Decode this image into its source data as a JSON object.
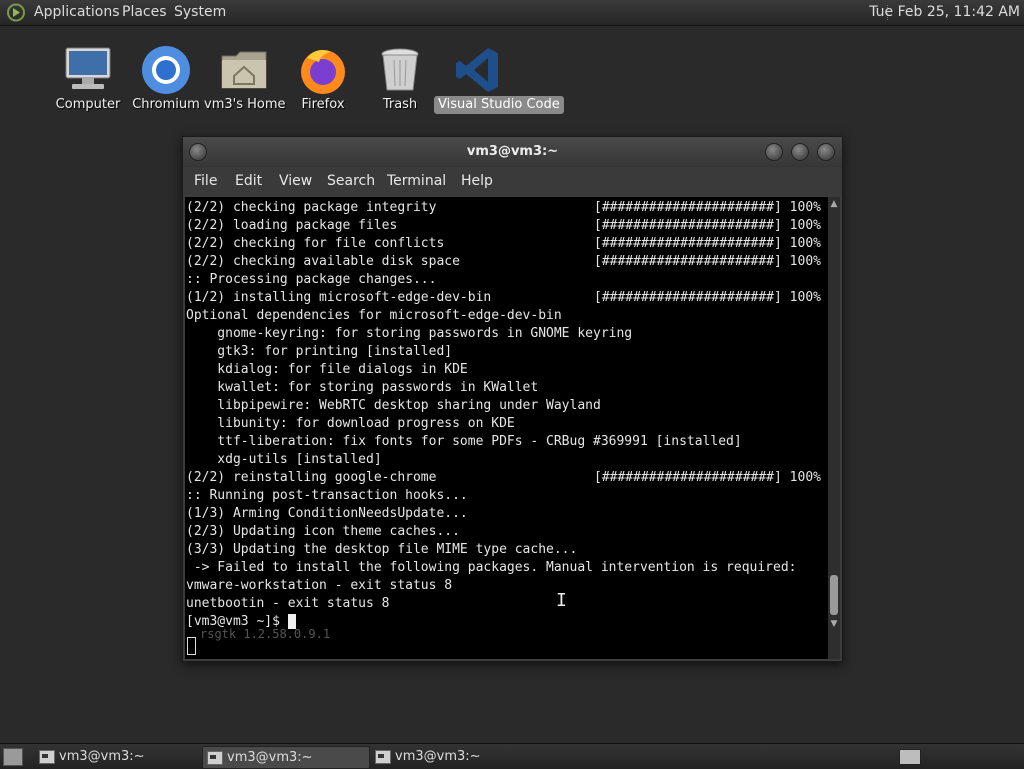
{
  "top_panel": {
    "menus": [
      "Applications",
      "Places",
      "System"
    ],
    "clock": "Tue Feb 25, 11:42 AM"
  },
  "desktop_icons": [
    {
      "label": "Computer",
      "icon": "computer-icon"
    },
    {
      "label": "Chromium",
      "icon": "chromium-icon"
    },
    {
      "label": "vm3's Home",
      "icon": "home-folder-icon"
    },
    {
      "label": "Firefox",
      "icon": "firefox-icon"
    },
    {
      "label": "Trash",
      "icon": "trash-icon"
    },
    {
      "label": "Visual Studio Code",
      "icon": "vscode-icon",
      "selected": true
    }
  ],
  "terminal": {
    "title": "vm3@vm3:~",
    "menu": [
      "File",
      "Edit",
      "View",
      "Search",
      "Terminal",
      "Help"
    ],
    "lines": [
      {
        "text": "(2/2) checking package integrity",
        "bar": "[######################] 100%"
      },
      {
        "text": "(2/2) loading package files",
        "bar": "[######################] 100%"
      },
      {
        "text": "(2/2) checking for file conflicts",
        "bar": "[######################] 100%"
      },
      {
        "text": "(2/2) checking available disk space",
        "bar": "[######################] 100%"
      },
      {
        "text": ":: Processing package changes...",
        "bar": ""
      },
      {
        "text": "(1/2) installing microsoft-edge-dev-bin",
        "bar": "[######################] 100%"
      },
      {
        "text": "Optional dependencies for microsoft-edge-dev-bin",
        "bar": ""
      },
      {
        "text": "    gnome-keyring: for storing passwords in GNOME keyring",
        "bar": ""
      },
      {
        "text": "    gtk3: for printing [installed]",
        "bar": ""
      },
      {
        "text": "    kdialog: for file dialogs in KDE",
        "bar": ""
      },
      {
        "text": "    kwallet: for storing passwords in KWallet",
        "bar": ""
      },
      {
        "text": "    libpipewire: WebRTC desktop sharing under Wayland",
        "bar": ""
      },
      {
        "text": "    libunity: for download progress on KDE",
        "bar": ""
      },
      {
        "text": "    ttf-liberation: fix fonts for some PDFs - CRBug #369991 [installed]",
        "bar": ""
      },
      {
        "text": "    xdg-utils [installed]",
        "bar": ""
      },
      {
        "text": "(2/2) reinstalling google-chrome",
        "bar": "[######################] 100%"
      },
      {
        "text": ":: Running post-transaction hooks...",
        "bar": ""
      },
      {
        "text": "(1/3) Arming ConditionNeedsUpdate...",
        "bar": ""
      },
      {
        "text": "(2/3) Updating icon theme caches...",
        "bar": ""
      },
      {
        "text": "(3/3) Updating the desktop file MIME type cache...",
        "bar": ""
      },
      {
        "text": " -> Failed to install the following packages. Manual intervention is required:",
        "bar": ""
      },
      {
        "text": "vmware-workstation - exit status 8",
        "bar": ""
      },
      {
        "text": "unetbootin - exit status 8",
        "bar": ""
      },
      {
        "text": "[vm3@vm3 ~]$ ",
        "bar": ""
      }
    ],
    "lower_ghost": "rsgtk 1.2.58.0.9.1"
  },
  "taskbar": {
    "tasks": [
      {
        "label": "vm3@vm3:~",
        "active": false
      },
      {
        "label": "vm3@vm3:~",
        "active": true
      },
      {
        "label": "vm3@vm3:~",
        "active": false
      }
    ]
  },
  "colors": {
    "desktop_bg": "#2a2a2a",
    "terminal_bg": "#000000",
    "terminal_fg": "#e6e6e6"
  }
}
